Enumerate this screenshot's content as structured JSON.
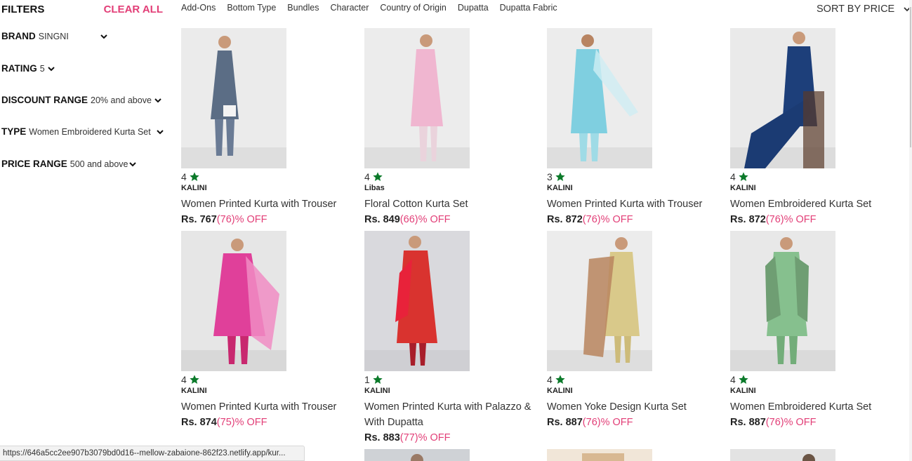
{
  "filters": {
    "title": "FILTERS",
    "clear_all": "CLEAR ALL",
    "items": [
      {
        "name": "BRAND",
        "value": "SINGNI"
      },
      {
        "name": "RATING",
        "value": "5"
      },
      {
        "name": "DISCOUNT RANGE",
        "value": "20% and above"
      },
      {
        "name": "TYPE",
        "value": "Women Embroidered Kurta Set"
      },
      {
        "name": "PRICE RANGE",
        "value": "500 and above"
      }
    ]
  },
  "categories": [
    "Add-Ons",
    "Bottom Type",
    "Bundles",
    "Character",
    "Country of Origin",
    "Dupatta",
    "Dupatta Fabric"
  ],
  "sort": {
    "label": "SORT BY PRICE"
  },
  "products": [
    {
      "rating": "4",
      "brand": "KALINI",
      "name": "Women Printed Kurta with Trouser",
      "price": "Rs. 767",
      "discount": "(76)% OFF"
    },
    {
      "rating": "4",
      "brand": "Libas",
      "name": "Floral Cotton Kurta Set",
      "price": "Rs. 849",
      "discount": "(66)% OFF"
    },
    {
      "rating": "3",
      "brand": "KALINI",
      "name": "Women Printed Kurta with Trouser",
      "price": "Rs. 872",
      "discount": "(76)% OFF"
    },
    {
      "rating": "4",
      "brand": "KALINI",
      "name": "Women Embroidered Kurta Set",
      "price": "Rs. 872",
      "discount": "(76)% OFF"
    },
    {
      "rating": "4",
      "brand": "KALINI",
      "name": "Women Printed Kurta with Trouser",
      "price": "Rs. 874",
      "discount": "(75)% OFF"
    },
    {
      "rating": "1",
      "brand": "KALINI",
      "name": "Women Printed Kurta with Palazzo & With Dupatta",
      "price": "Rs. 883",
      "discount": "(77)% OFF"
    },
    {
      "rating": "4",
      "brand": "KALINI",
      "name": "Women Yoke Design Kurta Set",
      "price": "Rs. 887",
      "discount": "(76)% OFF"
    },
    {
      "rating": "4",
      "brand": "KALINI",
      "name": "Women Embroidered Kurta Set",
      "price": "Rs. 887",
      "discount": "(76)% OFF"
    }
  ],
  "status_url": "https://646a5cc2ee907b3079bd0d16--mellow-zabaione-862f23.netlify.app/kur...",
  "colors": {
    "accent": "#e23e77",
    "star": "#0b7a2a"
  },
  "icons": {
    "star": "star-icon",
    "chevron": "chevron-down-icon"
  }
}
